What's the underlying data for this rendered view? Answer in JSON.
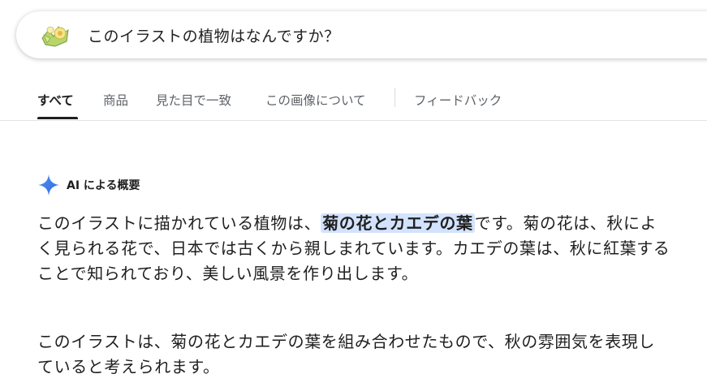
{
  "search": {
    "query": "このイラストの植物はなんですか？",
    "thumbnail_icon": "plant-illustration-thumbnail"
  },
  "tabs": [
    {
      "label": "すべて",
      "active": true
    },
    {
      "label": "商品",
      "active": false
    },
    {
      "label": "見た目で一致",
      "active": false
    },
    {
      "label": "この画像について",
      "active": false
    },
    {
      "label": "フィードバック",
      "active": false
    }
  ],
  "ai_overview": {
    "icon": "sparkle-icon",
    "title": "AI による概要",
    "p1_before": "このイラストに描かれている植物は、",
    "p1_highlight": "菊の花とカエデの葉",
    "p1_after": "です。菊の花は、秋によく見られる花で、日本では古くから親しまれています。カエデの葉は、秋に紅葉することで知られており、美しい風景を作り出します。",
    "p2": "このイラストは、菊の花とカエデの葉を組み合わせたもので、秋の雰囲気を表現していると考えられます。"
  },
  "colors": {
    "highlight": "#d3e3fd",
    "sparkle": "#4285f4"
  }
}
